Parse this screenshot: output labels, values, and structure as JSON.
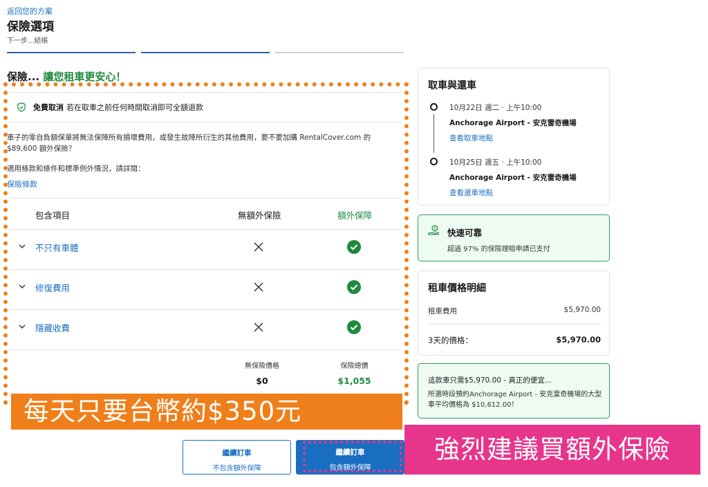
{
  "header": {
    "back_link": "返回您的方案",
    "title": "保險選項",
    "subtitle": "下一步...結帳"
  },
  "heading": {
    "prefix": "保險... ",
    "highlight": "讓您租車更安心！"
  },
  "free_cancel": {
    "bold": "免費取消",
    "text": "若在取車之前任何時間取消即可全額退款"
  },
  "description": "車子的零自負額保單將無法保障所有損壞費用，或發生故障所衍生的其他費用，要不要加購 RentalCover.com 的 $89,600 額外保險？",
  "terms_text": "適用條款和條件和標準例外情況，請詳閱：",
  "terms_link": "保險條款",
  "table": {
    "headers": {
      "item": "包含項目",
      "no_cover": "無額外保險",
      "cover": "額外保障"
    },
    "rows": [
      {
        "label": "不只有車體"
      },
      {
        "label": "修復費用"
      },
      {
        "label": "隱藏收費"
      }
    ],
    "price_no_label": "無保險價格",
    "price_no_value": "$0",
    "price_yes_label": "保險總價",
    "price_yes_value": "$1,055"
  },
  "overlays": {
    "orange_text": "每天只要台幣約$350元",
    "pink_text": "強烈建議買額外保險",
    "orange_color": "#ef7f1a",
    "pink_color": "#e6358b"
  },
  "buttons": {
    "no_cover_l1": "繼續訂車",
    "no_cover_l2": "不包含額外保障",
    "cover_l1": "繼續訂車",
    "cover_l2": "包含額外保障"
  },
  "pickup": {
    "title": "取車與還車",
    "pick_date": "10月22日 週二 · 上午10:00",
    "pick_loc": "Anchorage Airport - 安克雷奇機場",
    "pick_link": "查看取車地點",
    "drop_date": "10月25日 週五 · 上午10:00",
    "drop_loc": "Anchorage Airport - 安克雷奇機場",
    "drop_link": "查看還車地點"
  },
  "reliable": {
    "title": "快速可靠",
    "text": "超過 97% 的保險理賠申請已支付"
  },
  "price": {
    "title": "租車價格明細",
    "row1_label": "租車費用",
    "row1_value": "$5,970.00",
    "row2_label": "3天的價格：",
    "row2_value": "$5,970.00"
  },
  "deal": {
    "line1": "這款車只需$5,970.00 - 真正的便宜...",
    "line2": "所選時段預約Anchorage Airport - 安克雷奇機場的大型車平均價格為 $10,612.00！"
  },
  "colors": {
    "accent": "#1a6ec2",
    "green": "#1f8a3f"
  }
}
